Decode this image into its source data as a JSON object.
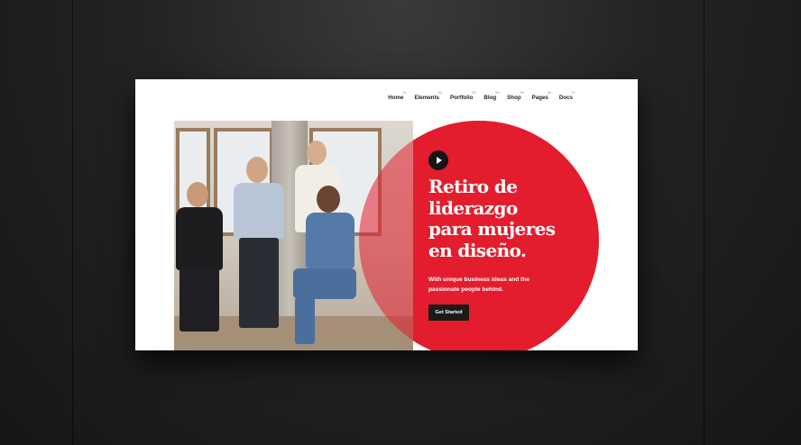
{
  "nav": {
    "items": [
      {
        "num": "01",
        "label": "Home"
      },
      {
        "num": "02",
        "label": "Elements"
      },
      {
        "num": "03",
        "label": "Portfolio"
      },
      {
        "num": "04",
        "label": "Blog"
      },
      {
        "num": "05",
        "label": "Shop"
      },
      {
        "num": "06",
        "label": "Pages"
      },
      {
        "num": "07",
        "label": "Docs"
      }
    ]
  },
  "hero": {
    "headline_lines": [
      "Retiro de",
      "liderazgo",
      "para mujeres",
      "en diseño."
    ],
    "subtitle_lines": [
      "With unique business ideas and the",
      "passionate people behind."
    ],
    "cta_label": "Get Started",
    "accent_color": "#e31e2e",
    "play_icon": "play-icon"
  }
}
